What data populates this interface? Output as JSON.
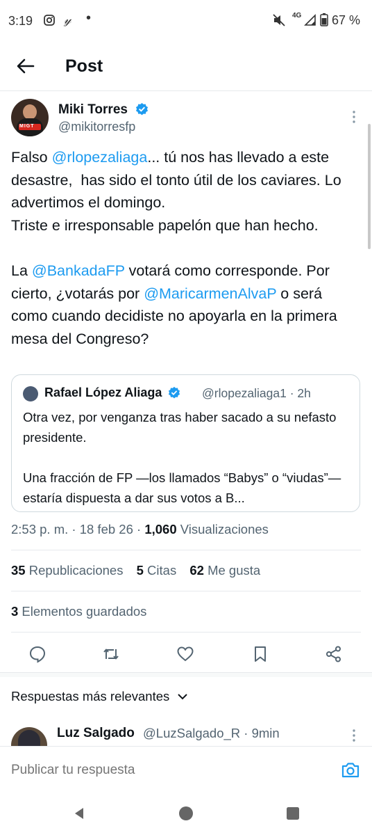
{
  "status_bar": {
    "time": "3:19",
    "network": "4G",
    "battery": "67 %",
    "icons": [
      "instagram-icon",
      "yahoo-icon",
      "dot-icon",
      "mute-icon",
      "signal-icon",
      "battery-icon"
    ]
  },
  "header": {
    "title": "Post",
    "back_icon": "arrow-left-icon"
  },
  "tweet": {
    "author_name": "Miki Torres",
    "author_handle": "@mikitorresfp",
    "avatar_label": "MIGT",
    "text_segments": [
      {
        "text": "Falso ",
        "type": "text"
      },
      {
        "text": "@rlopezaliaga",
        "type": "mention"
      },
      {
        "text": "... tú nos has llevado a este desastre,  has sido el tonto útil de los caviares. Lo advertimos el domingo.\nTriste e irresponsable papelón que han hecho.\n\nLa ",
        "type": "text"
      },
      {
        "text": "@BankadaFP",
        "type": "mention"
      },
      {
        "text": " votará como corresponde. Por cierto, ¿votarás por ",
        "type": "text"
      },
      {
        "text": "@MaricarmenAlvaP",
        "type": "mention"
      },
      {
        "text": " o será como cuando decidiste no apoyarla en la primera mesa del Congreso?",
        "type": "text"
      }
    ],
    "quote": {
      "author_name": "Rafael López Aliaga",
      "author_handle": "@rlopezaliaga1 · 2h",
      "text": "Otra vez, por venganza tras haber sacado a su nefasto presidente.\n\nUna fracción de FP —los llamados “Babys” o “viudas”— estaría dispuesta a dar sus votos a B..."
    },
    "meta": {
      "time_date": "2:53 p. m. · 18 feb 26 · ",
      "views_count": "1,060",
      "views_label": " Visualizaciones"
    },
    "stats": {
      "reposts_count": "35",
      "reposts_label": " Republicaciones",
      "quotes_count": "5",
      "quotes_label": " Citas",
      "likes_count": "62",
      "likes_label": " Me gusta"
    },
    "bookmarks": {
      "count": "3",
      "label": " Elementos guardados"
    }
  },
  "actions": [
    "reply-icon",
    "repost-icon",
    "like-icon",
    "bookmark-icon",
    "share-icon"
  ],
  "replies": {
    "sort_label": "Respuestas más relevantes",
    "first_reply": {
      "author_name": "Luz Salgado",
      "author_handle": "@LuzSalgado_R · 9min"
    }
  },
  "reply_bar": {
    "placeholder": "Publicar tu respuesta"
  },
  "colors": {
    "accent": "#1d9bf0",
    "text": "#0f1419",
    "secondary": "#536471",
    "border": "#cfd9de"
  }
}
